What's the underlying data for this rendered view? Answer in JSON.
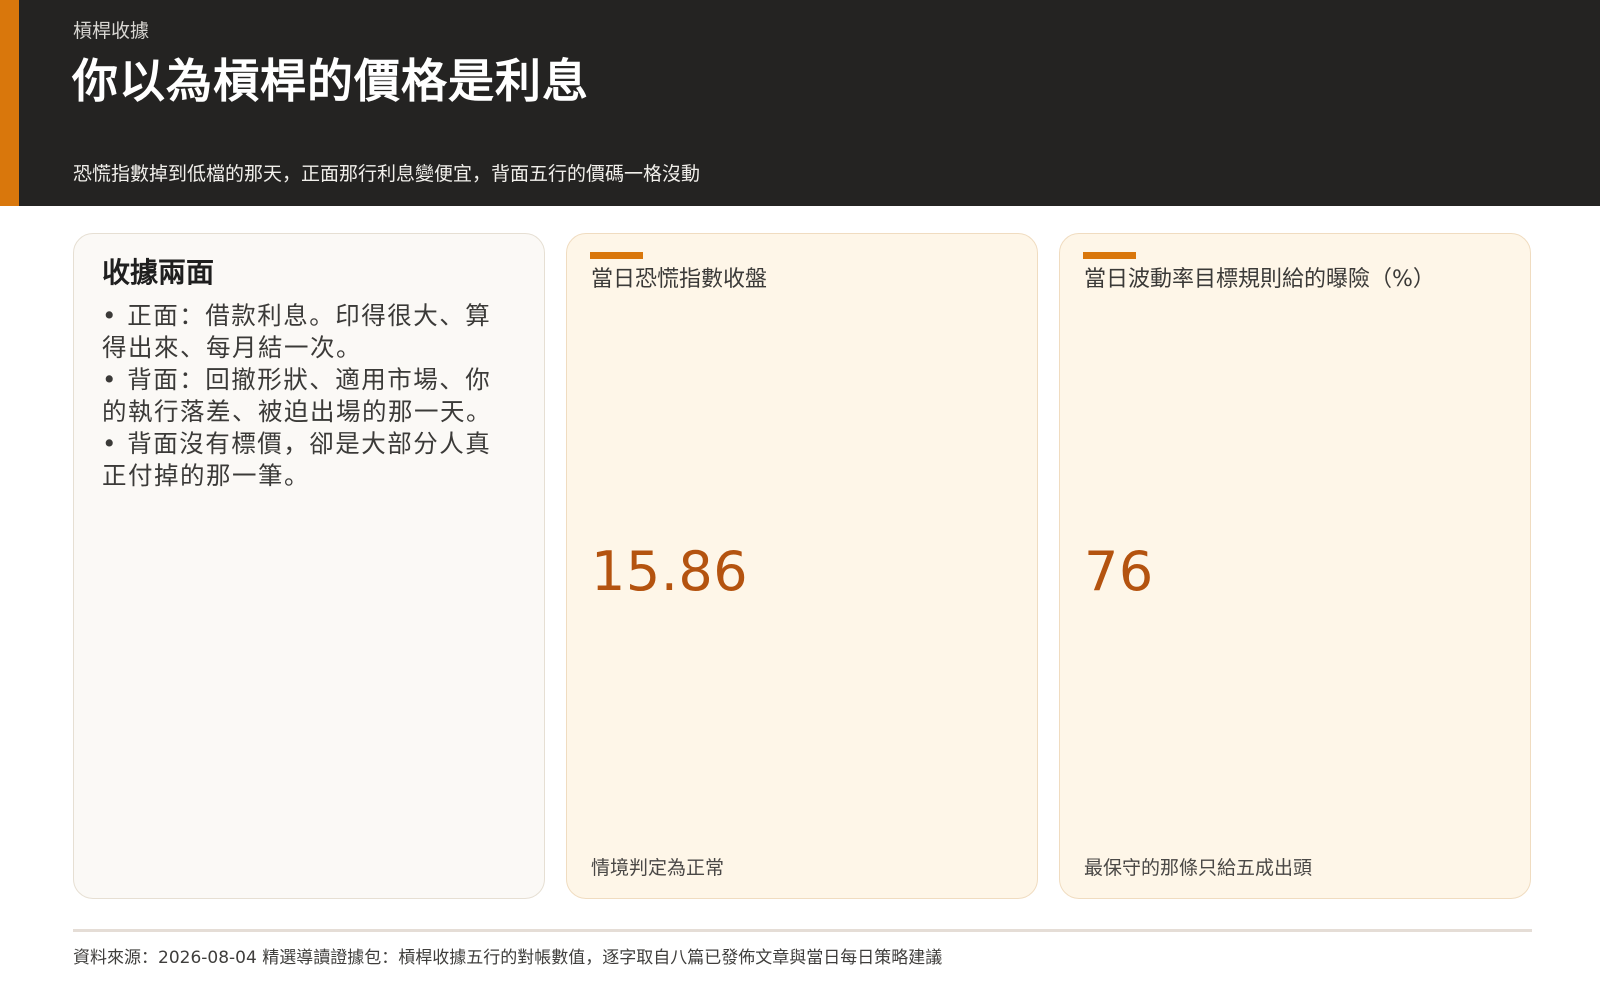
{
  "header": {
    "kicker": "槓桿收據",
    "title": "你以為槓桿的價格是利息",
    "subtitle": "恐慌指數掉到低檔的那天，正面那行利息變便宜，背面五行的價碼一格沒動"
  },
  "note_card": {
    "heading": "收據兩面",
    "items": [
      "• 正面：借款利息。印得很大、算得出來、每月結一次。",
      "• 背面：回撤形狀、適用市場、你的執行落差、被迫出場的那一天。",
      "• 背面沒有標價，卻是大部分人真正付掉的那一筆。"
    ]
  },
  "metrics": [
    {
      "label": "當日恐慌指數收盤",
      "value": "15.86",
      "note": "情境判定為正常"
    },
    {
      "label": "當日波動率目標規則給的曝險（%）",
      "value": "76",
      "note": "最保守的那條只給五成出頭"
    }
  ],
  "footer": {
    "source": "資料來源：2026-08-04 精選導讀證據包：槓桿收據五行的對帳數值，逐字取自八篇已發佈文章與當日每日策略建議"
  },
  "colors": {
    "header_bg": "#242322",
    "accent": "#d9770c",
    "value_text": "#b4530f",
    "metric_card_bg": "#fef6e8",
    "note_card_bg": "#fbf9f6"
  }
}
